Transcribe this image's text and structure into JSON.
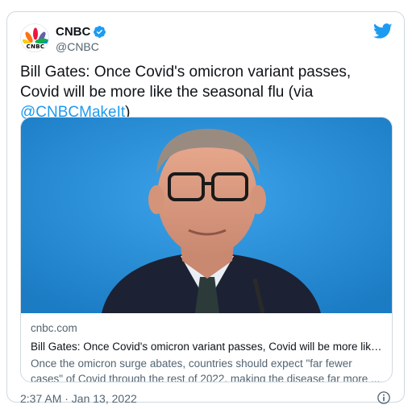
{
  "tweet": {
    "display_name": "CNBC",
    "handle": "@CNBC",
    "avatar_text": "CNBC",
    "text_before_mention": "Bill Gates: Once Covid's omicron variant passes, Covid will be more like the seasonal flu (via ",
    "mention": "@CNBCMakeIt",
    "text_after_mention": ")",
    "timestamp": "2:37 AM · Jan 13, 2022"
  },
  "link_card": {
    "domain": "cnbc.com",
    "title": "Bill Gates: Once Covid's omicron variant passes, Covid will be more like t...",
    "description": "Once the omicron surge abates, countries should expect \"far fewer cases\" of Covid through the rest of 2022, making the disease far more ..."
  },
  "icons": {
    "verified": "verified-badge-icon",
    "bird": "twitter-bird-icon",
    "info": "info-icon"
  },
  "colors": {
    "accent": "#1d9bf0",
    "text_primary": "#0f1419",
    "text_secondary": "#536471",
    "border": "#cfd9de",
    "image_background": "#2a8ed6"
  }
}
